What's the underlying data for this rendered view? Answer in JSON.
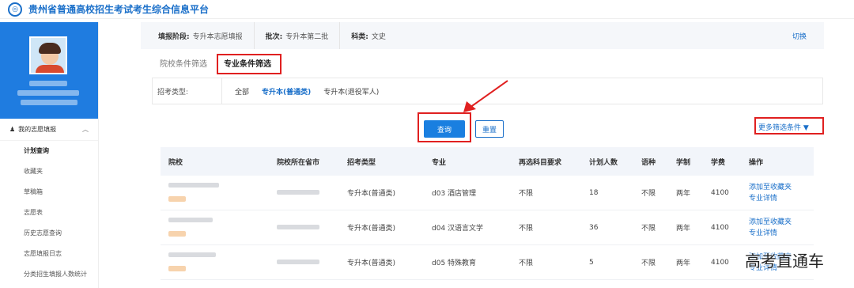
{
  "app": {
    "title": "贵州省普通高校招生考试考生综合信息平台",
    "logo_icon": "platform-logo-icon"
  },
  "sidebar": {
    "section_title": "我的志愿填报",
    "items": [
      {
        "label": "计划查询",
        "active": true
      },
      {
        "label": "收藏夹",
        "active": false
      },
      {
        "label": "草稿箱",
        "active": false
      },
      {
        "label": "志愿表",
        "active": false
      },
      {
        "label": "历史志愿查询",
        "active": false
      },
      {
        "label": "志愿填报日志",
        "active": false
      },
      {
        "label": "分类招生填报人数统计",
        "active": false
      }
    ]
  },
  "info_bar": {
    "stage_label": "填报阶段:",
    "stage_value": "专升本志愿填报",
    "batch_label": "批次:",
    "batch_value": "专升本第二批",
    "subject_label": "科类:",
    "subject_value": "文史",
    "switch_label": "切换"
  },
  "tabs": [
    {
      "label": "院校条件筛选",
      "active": false
    },
    {
      "label": "专业条件筛选",
      "active": true
    }
  ],
  "filter": {
    "label": "招考类型:",
    "options": [
      {
        "label": "全部",
        "active": false
      },
      {
        "label": "专升本(普通类)",
        "active": true
      },
      {
        "label": "专升本(退役军人)",
        "active": false
      }
    ]
  },
  "buttons": {
    "query": "查询",
    "reset": "重置",
    "more_filters": "更多筛选条件"
  },
  "table": {
    "headers": [
      "院校",
      "院校所在省市",
      "招考类型",
      "专业",
      "再选科目要求",
      "计划人数",
      "语种",
      "学制",
      "学费",
      "操作"
    ],
    "rows": [
      {
        "type": "专升本(普通类)",
        "major": "d03 酒店管理",
        "requirement": "不限",
        "plan": "18",
        "language": "不限",
        "duration": "两年",
        "fee": "4100",
        "action1": "添加至收藏夹",
        "action2": "专业详情"
      },
      {
        "type": "专升本(普通类)",
        "major": "d04 汉语言文学",
        "requirement": "不限",
        "plan": "36",
        "language": "不限",
        "duration": "两年",
        "fee": "4100",
        "action1": "添加至收藏夹",
        "action2": "专业详情"
      },
      {
        "type": "专升本(普通类)",
        "major": "d05 特殊教育",
        "requirement": "不限",
        "plan": "5",
        "language": "不限",
        "duration": "两年",
        "fee": "4100",
        "action1": "添加至收藏夹",
        "action2": "专业详情"
      }
    ]
  },
  "watermark": "高考直通车",
  "colors": {
    "primary": "#1a7fe0",
    "highlight": "#e02020",
    "sidebar_profile": "#1f7ce0"
  }
}
